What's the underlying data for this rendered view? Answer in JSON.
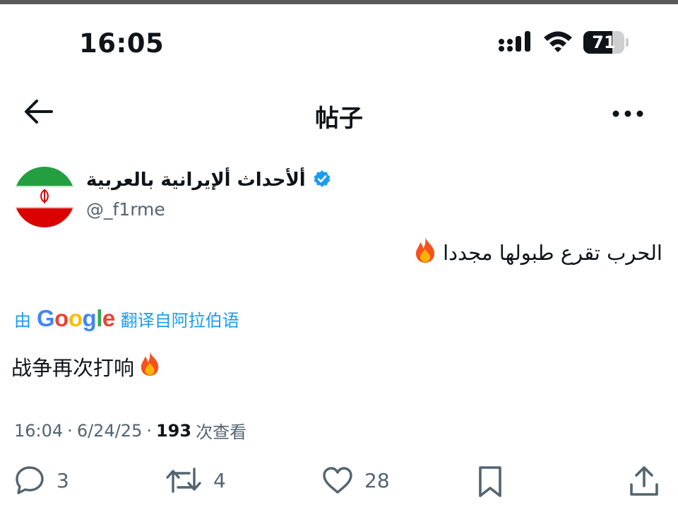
{
  "status_bar": {
    "time": "16:05",
    "battery_level": "71",
    "battery_fraction": 0.71,
    "icons": [
      "cellular-signal-icon",
      "wifi-icon",
      "battery-icon"
    ]
  },
  "nav": {
    "title": "帖子",
    "back_icon": "arrow-left-icon",
    "more_icon": "more-horizontal-icon"
  },
  "author": {
    "name": "ألأحداث ألإيرانية بالعربية",
    "handle": "@_f1rme",
    "verified": true,
    "verified_color": "#1d9bf0",
    "avatar": "iran-flag"
  },
  "tweet": {
    "text": "الحرب تقرع طبولها مجددا",
    "emoji": "🔥"
  },
  "translation": {
    "prefix": "由",
    "provider": "Google",
    "suffix": "翻译自阿拉伯语",
    "text": "战争再次打响",
    "emoji": "🔥"
  },
  "meta": {
    "time": "16:04",
    "separator": "·",
    "date": "6/24/25",
    "views_count": "193",
    "views_label": "次查看"
  },
  "actions": {
    "replies": "3",
    "retweets": "4",
    "likes": "28"
  },
  "colors": {
    "accent": "#1d9bf0",
    "text": "#0f1419",
    "secondary": "#536471"
  }
}
